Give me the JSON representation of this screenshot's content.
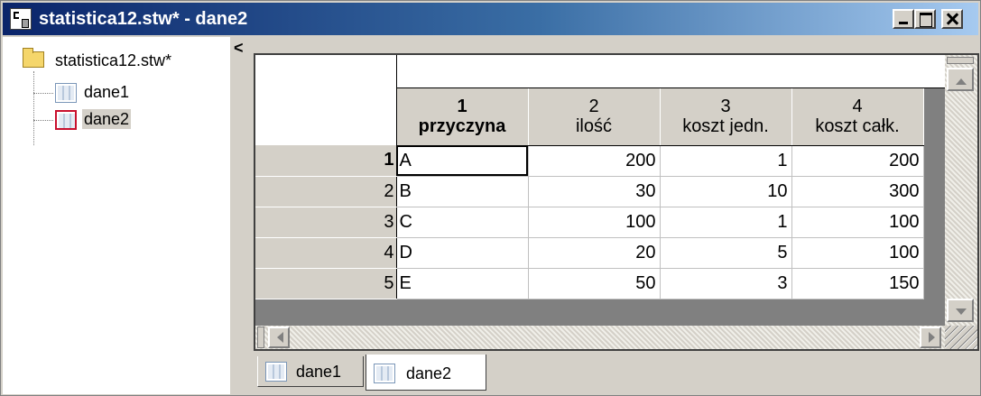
{
  "window": {
    "title": "statistica12.stw* - dane2"
  },
  "tree": {
    "root": "statistica12.stw*",
    "items": [
      {
        "label": "dane1",
        "selected": false
      },
      {
        "label": "dane2",
        "selected": true
      }
    ]
  },
  "splitter": {
    "arrow": "<"
  },
  "spreadsheet": {
    "columns": [
      {
        "number": "1",
        "name": "przyczyna"
      },
      {
        "number": "2",
        "name": "ilość"
      },
      {
        "number": "3",
        "name": "koszt jedn."
      },
      {
        "number": "4",
        "name": "koszt całk."
      }
    ],
    "rows": [
      {
        "index": "1",
        "cells": [
          "A",
          "200",
          "1",
          "200"
        ]
      },
      {
        "index": "2",
        "cells": [
          "B",
          "30",
          "10",
          "300"
        ]
      },
      {
        "index": "3",
        "cells": [
          "C",
          "100",
          "1",
          "100"
        ]
      },
      {
        "index": "4",
        "cells": [
          "D",
          "20",
          "5",
          "100"
        ]
      },
      {
        "index": "5",
        "cells": [
          "E",
          "50",
          "3",
          "150"
        ]
      }
    ]
  },
  "tabs": [
    {
      "label": "dane1",
      "active": false
    },
    {
      "label": "dane2",
      "active": true
    }
  ],
  "colors": {
    "title_bar_start": "#0a246a",
    "title_bar_end": "#a6caf0",
    "chrome": "#d4d0c8",
    "selected_icon_border": "#c8102e"
  }
}
